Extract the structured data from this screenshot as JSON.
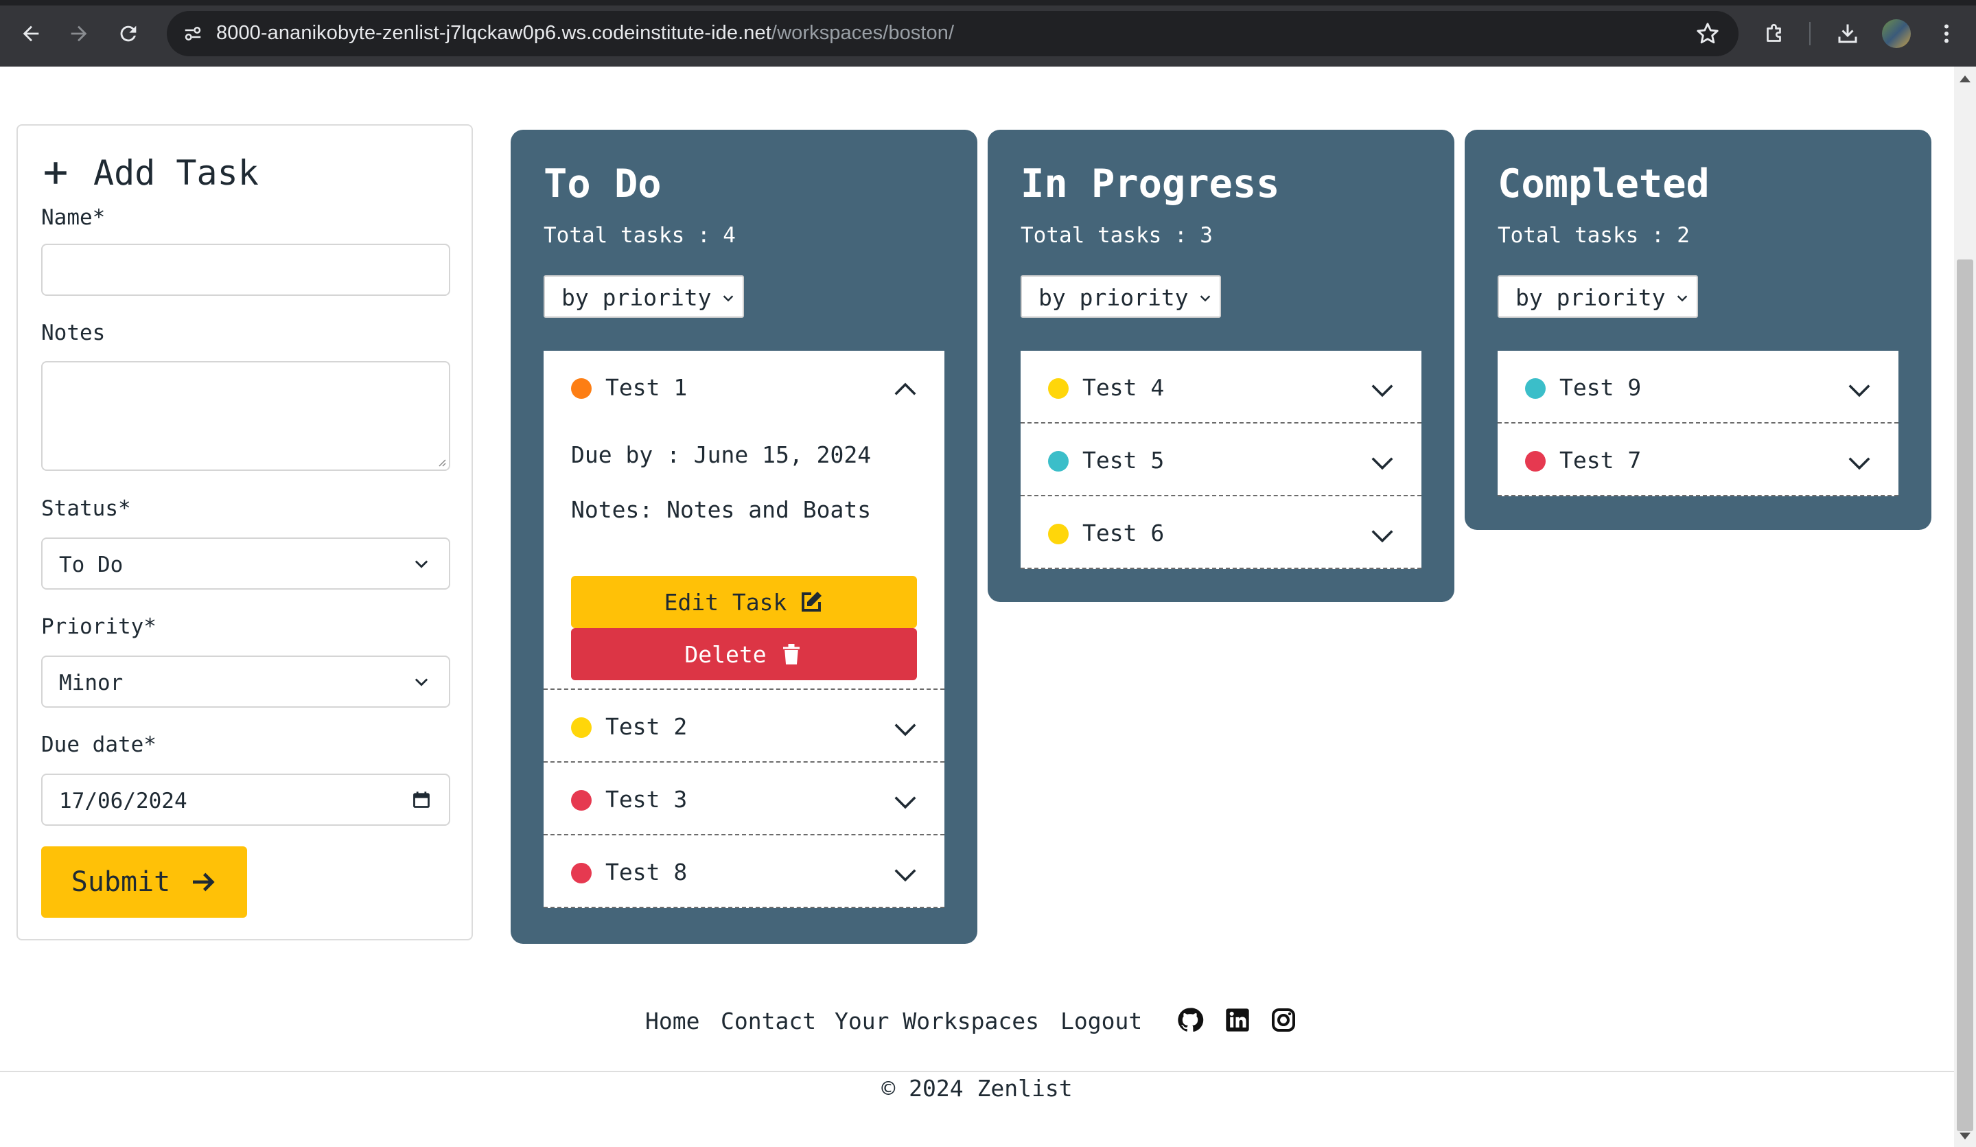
{
  "browser": {
    "url_host": "8000-ananikobyte-zenlist-j7lqckaw0p6.ws.codeinstitute-ide.net",
    "url_path": "/workspaces/boston/"
  },
  "form": {
    "title": "Add Task",
    "name_label": "Name*",
    "name_value": "",
    "notes_label": "Notes",
    "notes_value": "",
    "status_label": "Status*",
    "status_value": "To Do",
    "priority_label": "Priority*",
    "priority_value": "Minor",
    "due_label": "Due date*",
    "due_value": "17/06/2024",
    "submit_label": "Submit"
  },
  "columns": [
    {
      "title": "To Do",
      "total": "Total tasks : 4",
      "sort": "by priority",
      "tasks": [
        {
          "name": "Test 1",
          "color": "#fd7e14",
          "expanded": true,
          "due": "Due by : June 15, 2024",
          "notes": "Notes: Notes and Boats",
          "edit_label": "Edit Task",
          "delete_label": "Delete"
        },
        {
          "name": "Test 2",
          "color": "#ffd60a"
        },
        {
          "name": "Test 3",
          "color": "#e63950"
        },
        {
          "name": "Test 8",
          "color": "#e63950"
        }
      ]
    },
    {
      "title": "In Progress",
      "total": "Total tasks : 3",
      "sort": "by priority",
      "tasks": [
        {
          "name": "Test 4",
          "color": "#ffd60a"
        },
        {
          "name": "Test 5",
          "color": "#3bbec9"
        },
        {
          "name": "Test 6",
          "color": "#ffd60a"
        }
      ]
    },
    {
      "title": "Completed",
      "total": "Total tasks : 2",
      "sort": "by priority",
      "tasks": [
        {
          "name": "Test 9",
          "color": "#3bbec9"
        },
        {
          "name": "Test 7",
          "color": "#e63950"
        }
      ]
    }
  ],
  "footer": {
    "links": [
      "Home",
      "Contact",
      "Your Workspaces",
      "Logout"
    ],
    "icons": [
      "github-icon",
      "linkedin-icon",
      "instagram-icon"
    ],
    "copyright": "© 2024 Zenlist"
  },
  "colors": {
    "column_bg": "#456579",
    "accent_yellow": "#ffc107",
    "danger_red": "#dc3545"
  }
}
